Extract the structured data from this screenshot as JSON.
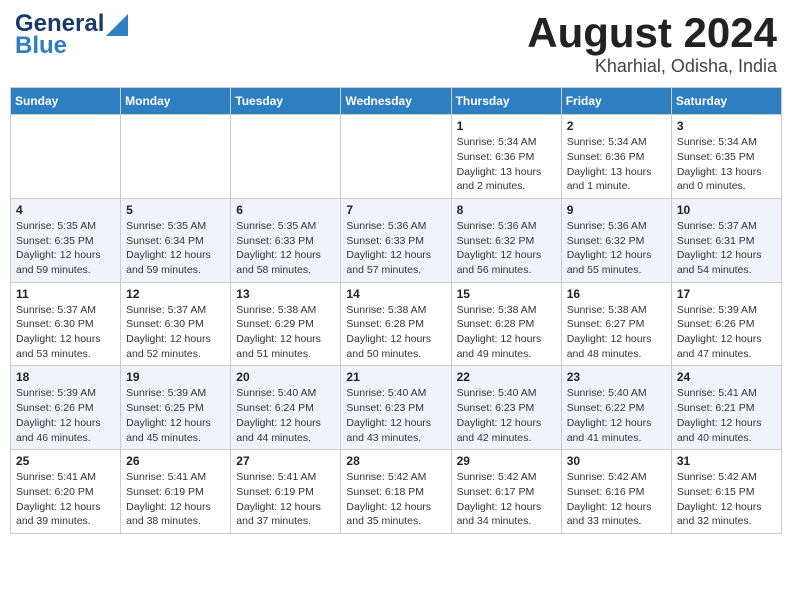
{
  "header": {
    "logo_line1": "General",
    "logo_line2": "Blue",
    "title": "August 2024",
    "subtitle": "Kharhial, Odisha, India"
  },
  "calendar": {
    "weekdays": [
      "Sunday",
      "Monday",
      "Tuesday",
      "Wednesday",
      "Thursday",
      "Friday",
      "Saturday"
    ],
    "rows": [
      [
        {
          "day": "",
          "info": ""
        },
        {
          "day": "",
          "info": ""
        },
        {
          "day": "",
          "info": ""
        },
        {
          "day": "",
          "info": ""
        },
        {
          "day": "1",
          "info": "Sunrise: 5:34 AM\nSunset: 6:36 PM\nDaylight: 13 hours\nand 2 minutes."
        },
        {
          "day": "2",
          "info": "Sunrise: 5:34 AM\nSunset: 6:36 PM\nDaylight: 13 hours\nand 1 minute."
        },
        {
          "day": "3",
          "info": "Sunrise: 5:34 AM\nSunset: 6:35 PM\nDaylight: 13 hours\nand 0 minutes."
        }
      ],
      [
        {
          "day": "4",
          "info": "Sunrise: 5:35 AM\nSunset: 6:35 PM\nDaylight: 12 hours\nand 59 minutes."
        },
        {
          "day": "5",
          "info": "Sunrise: 5:35 AM\nSunset: 6:34 PM\nDaylight: 12 hours\nand 59 minutes."
        },
        {
          "day": "6",
          "info": "Sunrise: 5:35 AM\nSunset: 6:33 PM\nDaylight: 12 hours\nand 58 minutes."
        },
        {
          "day": "7",
          "info": "Sunrise: 5:36 AM\nSunset: 6:33 PM\nDaylight: 12 hours\nand 57 minutes."
        },
        {
          "day": "8",
          "info": "Sunrise: 5:36 AM\nSunset: 6:32 PM\nDaylight: 12 hours\nand 56 minutes."
        },
        {
          "day": "9",
          "info": "Sunrise: 5:36 AM\nSunset: 6:32 PM\nDaylight: 12 hours\nand 55 minutes."
        },
        {
          "day": "10",
          "info": "Sunrise: 5:37 AM\nSunset: 6:31 PM\nDaylight: 12 hours\nand 54 minutes."
        }
      ],
      [
        {
          "day": "11",
          "info": "Sunrise: 5:37 AM\nSunset: 6:30 PM\nDaylight: 12 hours\nand 53 minutes."
        },
        {
          "day": "12",
          "info": "Sunrise: 5:37 AM\nSunset: 6:30 PM\nDaylight: 12 hours\nand 52 minutes."
        },
        {
          "day": "13",
          "info": "Sunrise: 5:38 AM\nSunset: 6:29 PM\nDaylight: 12 hours\nand 51 minutes."
        },
        {
          "day": "14",
          "info": "Sunrise: 5:38 AM\nSunset: 6:28 PM\nDaylight: 12 hours\nand 50 minutes."
        },
        {
          "day": "15",
          "info": "Sunrise: 5:38 AM\nSunset: 6:28 PM\nDaylight: 12 hours\nand 49 minutes."
        },
        {
          "day": "16",
          "info": "Sunrise: 5:38 AM\nSunset: 6:27 PM\nDaylight: 12 hours\nand 48 minutes."
        },
        {
          "day": "17",
          "info": "Sunrise: 5:39 AM\nSunset: 6:26 PM\nDaylight: 12 hours\nand 47 minutes."
        }
      ],
      [
        {
          "day": "18",
          "info": "Sunrise: 5:39 AM\nSunset: 6:26 PM\nDaylight: 12 hours\nand 46 minutes."
        },
        {
          "day": "19",
          "info": "Sunrise: 5:39 AM\nSunset: 6:25 PM\nDaylight: 12 hours\nand 45 minutes."
        },
        {
          "day": "20",
          "info": "Sunrise: 5:40 AM\nSunset: 6:24 PM\nDaylight: 12 hours\nand 44 minutes."
        },
        {
          "day": "21",
          "info": "Sunrise: 5:40 AM\nSunset: 6:23 PM\nDaylight: 12 hours\nand 43 minutes."
        },
        {
          "day": "22",
          "info": "Sunrise: 5:40 AM\nSunset: 6:23 PM\nDaylight: 12 hours\nand 42 minutes."
        },
        {
          "day": "23",
          "info": "Sunrise: 5:40 AM\nSunset: 6:22 PM\nDaylight: 12 hours\nand 41 minutes."
        },
        {
          "day": "24",
          "info": "Sunrise: 5:41 AM\nSunset: 6:21 PM\nDaylight: 12 hours\nand 40 minutes."
        }
      ],
      [
        {
          "day": "25",
          "info": "Sunrise: 5:41 AM\nSunset: 6:20 PM\nDaylight: 12 hours\nand 39 minutes."
        },
        {
          "day": "26",
          "info": "Sunrise: 5:41 AM\nSunset: 6:19 PM\nDaylight: 12 hours\nand 38 minutes."
        },
        {
          "day": "27",
          "info": "Sunrise: 5:41 AM\nSunset: 6:19 PM\nDaylight: 12 hours\nand 37 minutes."
        },
        {
          "day": "28",
          "info": "Sunrise: 5:42 AM\nSunset: 6:18 PM\nDaylight: 12 hours\nand 35 minutes."
        },
        {
          "day": "29",
          "info": "Sunrise: 5:42 AM\nSunset: 6:17 PM\nDaylight: 12 hours\nand 34 minutes."
        },
        {
          "day": "30",
          "info": "Sunrise: 5:42 AM\nSunset: 6:16 PM\nDaylight: 12 hours\nand 33 minutes."
        },
        {
          "day": "31",
          "info": "Sunrise: 5:42 AM\nSunset: 6:15 PM\nDaylight: 12 hours\nand 32 minutes."
        }
      ]
    ]
  }
}
